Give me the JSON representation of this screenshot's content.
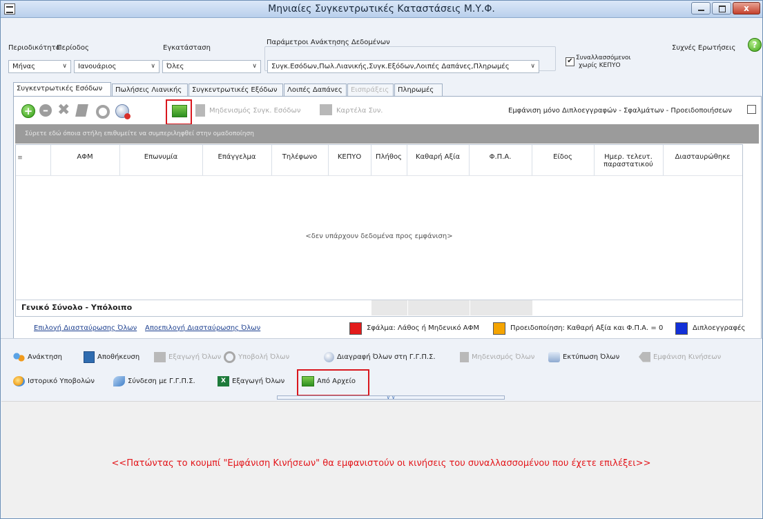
{
  "window": {
    "title": "Μηνιαίες Συγκεντρωτικές Καταστάσεις Μ.Υ.Φ.",
    "close_label": "x"
  },
  "filters": {
    "periodicity_label": "Περιοδικότητα",
    "periodicity_value": "Μήνας",
    "period_label": "Περίοδος",
    "period_value": "Ιανουάριος",
    "installation_label": "Εγκατάσταση",
    "installation_value": "Όλες",
    "params_label": "Παράμετροι Ανάκτησης Δεδομένων",
    "params_value": "Συγκ.Εσόδων,Πωλ.Λιανικής,Συγκ.Εξόδων,Λοιπές Δαπάνες,Πληρωμές",
    "no_kepyo_label_line1": "Συναλλασσόμενοι",
    "no_kepyo_label_line2": "χωρίς ΚΕΠΥΟ",
    "no_kepyo_checked": true,
    "faq_label": "Συχνές Ερωτήσεις",
    "help_glyph": "?"
  },
  "tabs": [
    {
      "label": "Συγκεντρωτικές Εσόδων",
      "active": true
    },
    {
      "label": "Πωλήσεις Λιανικής"
    },
    {
      "label": "Συγκεντρωτικές Εξόδων"
    },
    {
      "label": "Λοιπές Δαπάνες"
    },
    {
      "label": "Εισπράξεις",
      "disabled": true
    },
    {
      "label": "Πληρωμές"
    }
  ],
  "toolbar": {
    "zero_label": "Μηδενισμός Συγκ. Εσόδων",
    "card_label": "Καρτέλα Συν.",
    "show_only_label": "Εμφάνιση μόνο Διπλοεγγραφών - Σφαλμάτων - Προειδοποιήσεων"
  },
  "grid": {
    "group_hint": "Σύρετε εδώ όποια στήλη επιθυμείτε να συμπεριληφθεί στην ομαδοποίηση",
    "columns": [
      "ΑΦΜ",
      "Επωνυμία",
      "Επάγγελμα",
      "Τηλέφωνο",
      "ΚΕΠΥΟ",
      "Πλήθος",
      "Καθαρή Αξία",
      "Φ.Π.Α.",
      "Είδος",
      "Ημερ. τελευτ.",
      "παραστατικού",
      "Διασταυρώθηκε"
    ],
    "empty_text": "<δεν υπάρχουν δεδομένα προς εμφάνιση>",
    "footer_label": "Γενικό Σύνολο - Υπόλοιπο"
  },
  "links": {
    "select_all": "Επιλογή Διασταύρωσης Όλων",
    "deselect_all": "Αποεπιλογή Διασταύρωσης Όλων"
  },
  "legend": [
    {
      "color": "#e31b1b",
      "label": "Σφάλμα: Λάθος ή Μηδενικό ΑΦΜ"
    },
    {
      "color": "#f5a400",
      "label": "Προειδοποίηση: Καθαρή Αξία και Φ.Π.Α. = 0"
    },
    {
      "color": "#1230d8",
      "label": "Διπλοεγγραφές"
    }
  ],
  "actions": {
    "retrieve": "Ανάκτηση",
    "save": "Αποθήκευση",
    "export_all": "Εξαγωγή Όλων",
    "submit_all": "Υποβολή Όλων",
    "delete_all": "Διαγραφή Όλων στη Γ.Γ.Π.Σ.",
    "zero_all": "Μηδενισμός Όλων",
    "print_all": "Εκτύπωση Όλων",
    "show_movements": "Εμφάνιση Κινήσεων",
    "history": "Ιστορικό Υποβολών",
    "connect": "Σύνδεση με Γ.Γ.Π.Σ.",
    "excel_export": "Εξαγωγή Όλων",
    "from_file": "Από Αρχείο"
  },
  "bottom_message": "<<Πατώντας το κουμπί \"Εμφάνιση Κινήσεων\" θα εμφανιστούν οι κινήσεις του συναλλασσομένου που έχετε επιλέξει>>"
}
